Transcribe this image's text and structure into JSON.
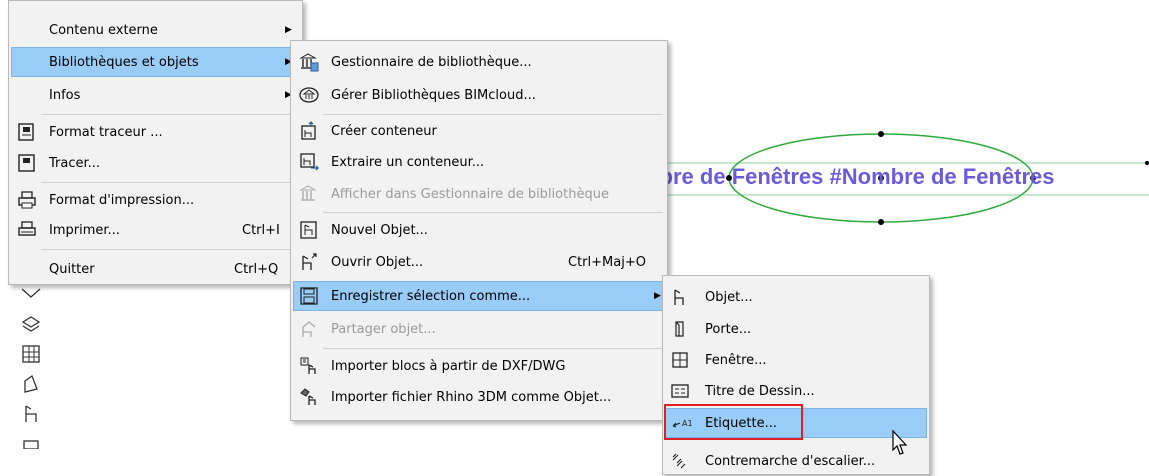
{
  "menu1": {
    "items": [
      {
        "label": "Contenu externe",
        "submenu": true
      },
      {
        "label": "Bibliothèques et objets",
        "submenu": true,
        "highlighted": true
      },
      {
        "label": "Infos",
        "submenu": true
      },
      {
        "label": "Format traceur ...",
        "icon": "plotter-format-icon"
      },
      {
        "label": "Tracer...",
        "icon": "plotter-icon"
      },
      {
        "label": "Format d'impression...",
        "icon": "print-setup-icon"
      },
      {
        "label": "Imprimer...",
        "shortcut": "Ctrl+I",
        "icon": "printer-icon"
      },
      {
        "label": "Quitter",
        "shortcut": "Ctrl+Q"
      }
    ]
  },
  "menu2": {
    "items": [
      {
        "label": "Gestionnaire de bibliothèque...",
        "icon": "library-manager-icon"
      },
      {
        "label": "Gérer Bibliothèques BIMcloud...",
        "icon": "bimcloud-library-icon"
      },
      {
        "label": "Créer conteneur",
        "icon": "create-container-icon"
      },
      {
        "label": "Extraire un conteneur...",
        "icon": "extract-container-icon"
      },
      {
        "label": "Afficher dans Gestionnaire de bibliothèque",
        "disabled": true,
        "icon": "show-in-library-icon"
      },
      {
        "label": "Nouvel Objet...",
        "icon": "new-object-icon"
      },
      {
        "label": "Ouvrir Objet...",
        "shortcut": "Ctrl+Maj+O",
        "icon": "open-object-icon"
      },
      {
        "label": "Enregistrer sélection comme...",
        "submenu": true,
        "highlighted": true,
        "icon": "save-selection-icon"
      },
      {
        "label": "Partager objet...",
        "disabled": true,
        "icon": "share-object-icon"
      },
      {
        "label": "Importer blocs à partir de DXF/DWG",
        "icon": "import-dxf-icon"
      },
      {
        "label": "Importer fichier Rhino 3DM comme Objet...",
        "icon": "import-rhino-icon"
      }
    ]
  },
  "menu3": {
    "items": [
      {
        "label": "Objet...",
        "icon": "object-icon"
      },
      {
        "label": "Porte...",
        "icon": "door-icon"
      },
      {
        "label": "Fenêtre...",
        "icon": "window-icon"
      },
      {
        "label": "Titre de Dessin...",
        "icon": "drawing-title-icon"
      },
      {
        "label": "Etiquette...",
        "icon": "label-icon",
        "highlighted": true
      },
      {
        "label": "Contremarche d'escalier...",
        "icon": "stair-riser-icon"
      }
    ]
  },
  "canvas": {
    "label_text": "mbre de Fenêtres #Nombre de Fenêtres"
  },
  "colors": {
    "highlight": "#99ccf7",
    "label_text": "#6a5bdc",
    "ellipse": "#2eaa3c",
    "guide_line": "#8fd19a",
    "red_box": "#e02020"
  }
}
